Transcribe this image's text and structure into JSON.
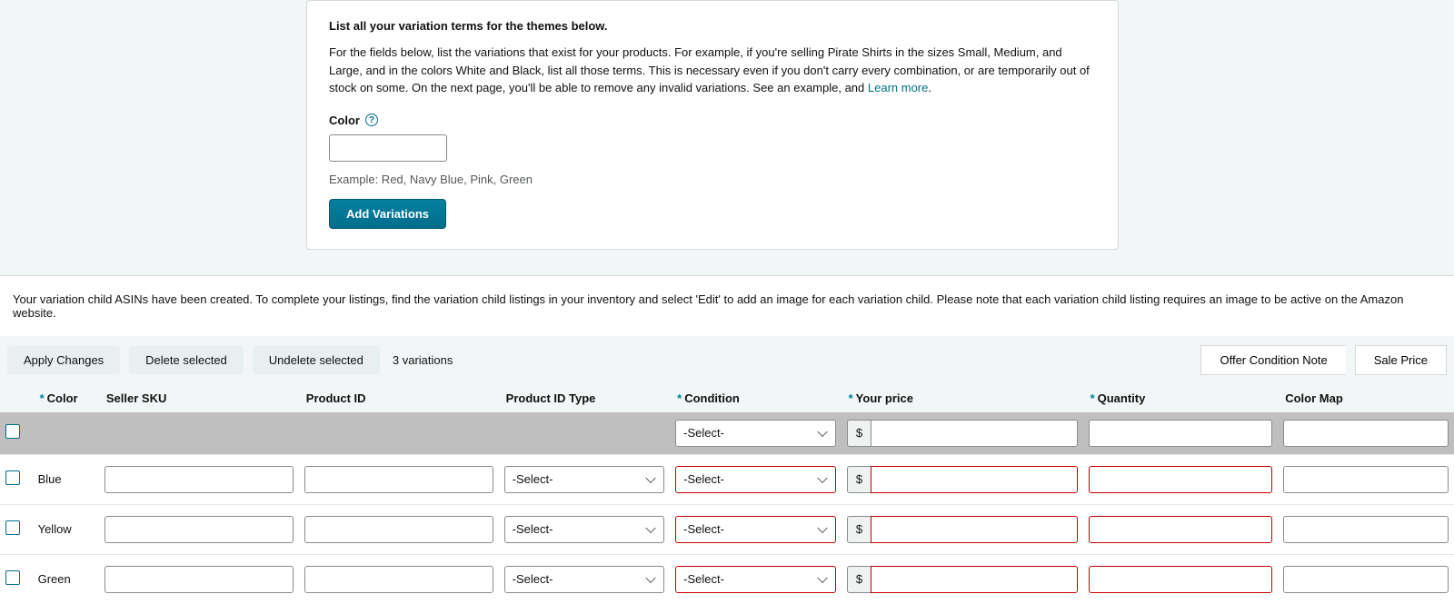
{
  "card": {
    "title": "List all your variation terms for the themes below.",
    "desc_1": "For the fields below, list the variations that exist for your products. For example, if you're selling Pirate Shirts in the sizes Small, Medium, and Large, and in the colors White and Black, list all those terms. This is necessary even if you don't carry every combination, or are temporarily out of stock on some. On the next page, you'll be able to remove any invalid variations. See an example, and ",
    "learn_more": "Learn more",
    "desc_suffix": ".",
    "color_label": "Color",
    "color_value": "",
    "example_text": "Example: Red, Navy Blue, Pink, Green",
    "add_btn": "Add Variations"
  },
  "notice": "Your variation child ASINs have been created. To complete your listings, find the variation child listings in your inventory and select 'Edit' to add an image for each variation child. Please note that each variation child listing requires an image to be active on the Amazon website.",
  "toolbar": {
    "apply": "Apply Changes",
    "delete": "Delete selected",
    "undelete": "Undelete selected",
    "count": "3 variations",
    "offer_note": "Offer Condition Note",
    "sale_price": "Sale Price"
  },
  "columns": {
    "color": "Color",
    "sku": "Seller SKU",
    "pid": "Product ID",
    "ptype": "Product ID Type",
    "cond": "Condition",
    "price": "Your price",
    "qty": "Quantity",
    "cmap": "Color Map"
  },
  "select_placeholder": "-Select-",
  "currency_symbol": "$",
  "rows": [
    {
      "color": "Blue",
      "sku": "",
      "pid": "",
      "ptype": "-Select-",
      "cond": "-Select-",
      "price": "",
      "qty": "",
      "cmap": ""
    },
    {
      "color": "Yellow",
      "sku": "",
      "pid": "",
      "ptype": "-Select-",
      "cond": "-Select-",
      "price": "",
      "qty": "",
      "cmap": ""
    },
    {
      "color": "Green",
      "sku": "",
      "pid": "",
      "ptype": "-Select-",
      "cond": "-Select-",
      "price": "",
      "qty": "",
      "cmap": ""
    }
  ]
}
